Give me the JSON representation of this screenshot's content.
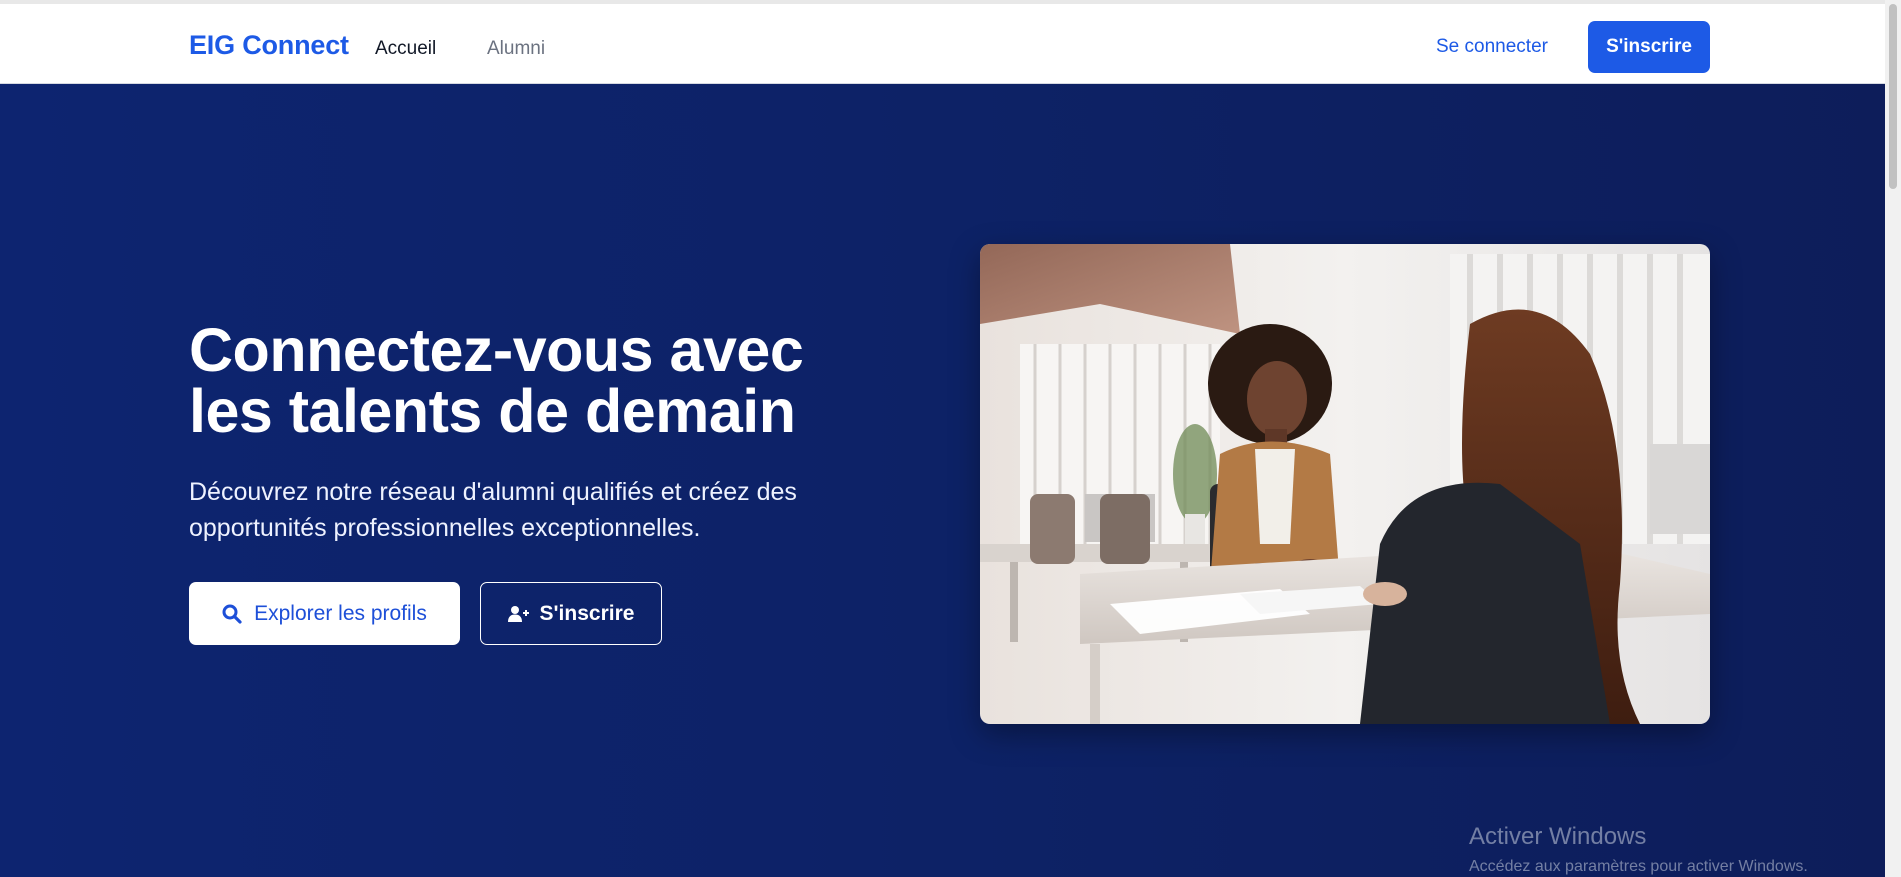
{
  "navbar": {
    "brand": "EIG Connect",
    "links": [
      "Accueil",
      "Alumni"
    ],
    "login_label": "Se connecter",
    "signup_label": "S'inscrire"
  },
  "hero": {
    "title_line1": "Connectez-vous avec",
    "title_line2": "les talents de demain",
    "subtitle_line1": "Découvrez notre réseau d'alumni qualifiés et créez des",
    "subtitle_line2": "opportunités professionnelles exceptionnelles.",
    "explore_label": "Explorer les profils",
    "signup_label": "S'inscrire",
    "explore_icon": "search-icon",
    "signup_icon": "user-plus-icon"
  },
  "watermark": {
    "title": "Activer Windows",
    "subtitle": "Accédez aux paramètres pour activer Windows."
  },
  "colors": {
    "brand": "#1d5ae6",
    "hero_bg": "#0d2266",
    "white": "#ffffff"
  }
}
